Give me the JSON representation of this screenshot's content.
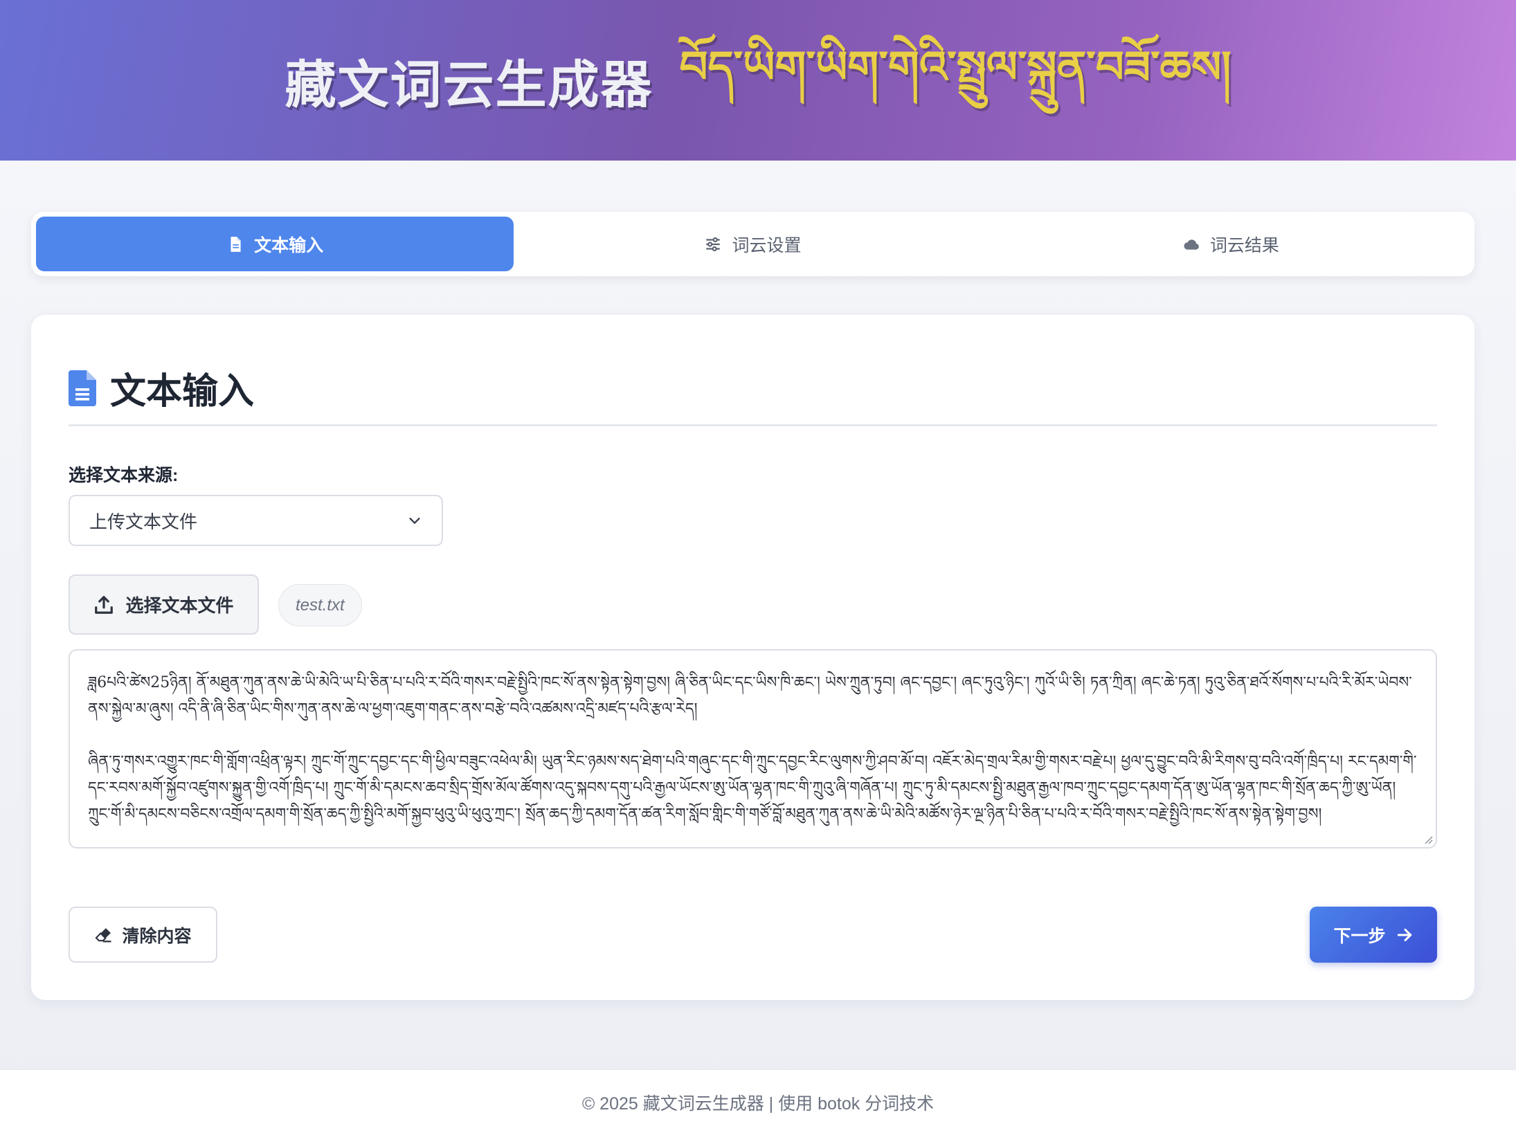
{
  "header": {
    "title_cn": "藏文词云生成器",
    "title_tb": "བོད་ཡིག་ཡིག་གེའི་སྤྲུལ་སྐྲུན་བཟོ་ཆས།"
  },
  "tabs": [
    {
      "label": "文本输入",
      "icon": "file-text-icon",
      "active": true
    },
    {
      "label": "词云设置",
      "icon": "sliders-icon",
      "active": false
    },
    {
      "label": "词云结果",
      "icon": "cloud-icon",
      "active": false
    }
  ],
  "main": {
    "section_title": "文本输入",
    "source_label": "选择文本来源:",
    "source_select": {
      "value": "上传文本文件"
    },
    "upload_button": "选择文本文件",
    "file_name": "test.txt",
    "text_content": [
      "ཟླ6པའི་ཚེས25ཉིན། ནོ་མཐུན་ཀུན་ནས་ཆེ་ཡི་མེའི་ཡ་པི་ཅིན་པ་པའི་ར་བོའི་གསར་བརྗེ་སྤྱིའི་ཁང་སོ་ནས་སྟེན་སྟེག་བྱས། ཞི་ཅིན་ཡིང་དང་ཡིས་ཁི་ཆང་། ཡེས་ཀྲུན་ཏུབ། ཞང་དབྱང་། ཞང་ཏུའུ་ཉིང་། ཀུའོ་ཡི་ཅི། ཏན་ཀྲིན། ཞང་ཆེ་ཏན། ཏུའུ་ཅིན་ཐའོ་སོགས་པ་པའི་རི་མོར་ཡེབས་ནས་སྐྱེལ་མ་ཞུས། འདི་ནི་ཞི་ཅིན་ཡིང་གིས་ཀུན་ནས་ཆེ་ལ་ཕྱག་འཇུག་གནང་ནས་བརྩེ་བའི་འཚམས་འདྲི་མཛད་པའི་རྩལ་རེད།",
      "ཞིན་ཏུ་གསར་འགྱུར་ཁང་གི་གློག་འཕྲིན་ལྟར། ཀྲུང་གོ་ཀྲུང་དབྱང་དང་གི་ཕྱིལ་བཟུང་འཕེལ་མི། ཡུན་རིང་ཉམས་སད་ཐེག་པའི་གཞུང་དང་གི་ཀྲུང་དབྱང་རིང་ལུགས་ཀྱི་ཤབ་མོ་བ། འཇོར་མེད་གྲལ་རིམ་གྱི་གསར་བརྗེ་པ། ཕྱལ་དུ་བྱུང་བའི་མི་རིགས་བུ་བའི་འགོ་ཁྲིད་པ། རང་དམག་གི་དང་རབས་མགོ་སྐྱོབ་འཛུགས་སྐྱུན་གྱི་འགོ་ཁྲིད་པ། ཀྲུང་གོ་མི་དམངས་ཆབ་སྲིད་གྲོས་མོལ་ཚོགས་འདུ་སྐབས་དགུ་པའི་རྒྱལ་ཡོངས་ཨུ་ཡོན་ལྷན་ཁང་གི་ཀྲུའུ་ཞི་གཞོན་པ། ཀྲུང་ཏུ་མི་དམངས་སྤྱི་མཐུན་རྒྱལ་ཁབ་ཀྲུང་དབྱང་དམག་དོན་ཨུ་ཡོན་ལྷན་ཁང་གི་སྲོན་ཆད་ཀྱི་ཨུ་ཡོན། ཀྲུང་གོ་མི་དམངས་བཅིངས་འགྲོལ་དམག་གི་སྲོན་ཆད་ཀྱི་སྤྱིའི་མགོ་སྐྱབ་ཕུའུ་ཡི་ཕུའུ་ཀྲང་། སྲོན་ཆད་ཀྱི་དམག་དོན་ཚན་རིག་སློབ་གླིང་གི་གཙོ་བློ་མཐུན་ཀུན་ནས་ཆེ་ཡི་མེའི་མཚོས་ཉེར་ལྔ་ཉིན་པི་ཅིན་པ་པའི་ར་བོའི་གསར་བརྗེ་སྤྱིའི་ཁང་སོ་ནས་སྟེན་སྟེག་བྱས།"
    ],
    "clear_button": "清除内容",
    "next_button": "下一步"
  },
  "footer": {
    "text": "© 2025 藏文词云生成器 | 使用 botok 分词技术"
  },
  "colors": {
    "accent": "#4f86ec",
    "title_gold": "#e9cf45",
    "header_start": "#6a70d4",
    "header_end": "#c183dd"
  }
}
